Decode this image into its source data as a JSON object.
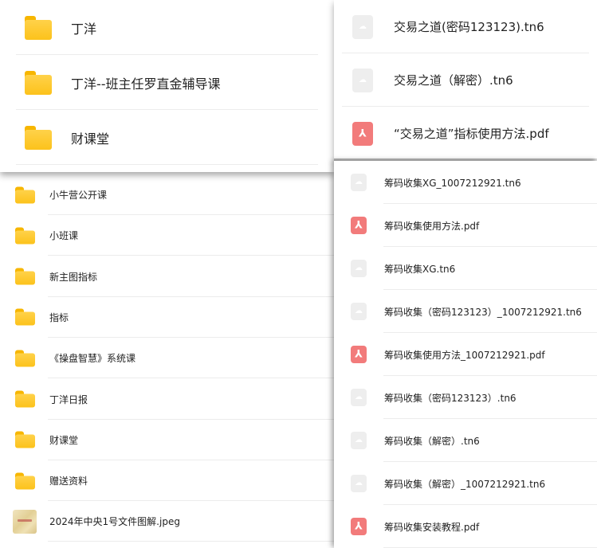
{
  "top_left_folders": [
    "丁洋",
    "丁洋--班主任罗直金辅导课",
    "财课堂"
  ],
  "top_right_files": [
    {
      "name": "交易之道(密码123123).tn6",
      "type": "tn6"
    },
    {
      "name": "交易之道（解密）.tn6",
      "type": "tn6"
    },
    {
      "name": "“交易之道”指标使用方法.pdf",
      "type": "pdf"
    }
  ],
  "bottom_left_items": [
    {
      "name": "小牛营公开课",
      "type": "folder"
    },
    {
      "name": "小班课",
      "type": "folder"
    },
    {
      "name": "新主图指标",
      "type": "folder"
    },
    {
      "name": "指标",
      "type": "folder"
    },
    {
      "name": "《操盘智慧》系统课",
      "type": "folder"
    },
    {
      "name": "丁洋日报",
      "type": "folder"
    },
    {
      "name": "财课堂",
      "type": "folder"
    },
    {
      "name": "赠送资料",
      "type": "folder"
    },
    {
      "name": "2024年中央1号文件图解.jpeg",
      "type": "image"
    }
  ],
  "bottom_right_files": [
    {
      "name": "筹码收集XG_1007212921.tn6",
      "type": "tn6"
    },
    {
      "name": "筹码收集使用方法.pdf",
      "type": "pdf"
    },
    {
      "name": "筹码收集XG.tn6",
      "type": "tn6"
    },
    {
      "name": "筹码收集（密码123123）_1007212921.tn6",
      "type": "tn6"
    },
    {
      "name": "筹码收集使用方法_1007212921.pdf",
      "type": "pdf"
    },
    {
      "name": "筹码收集（密码123123）.tn6",
      "type": "tn6"
    },
    {
      "name": "筹码收集（解密）.tn6",
      "type": "tn6"
    },
    {
      "name": "筹码收集（解密）_1007212921.tn6",
      "type": "tn6"
    },
    {
      "name": "筹码收集安装教程.pdf",
      "type": "pdf"
    }
  ],
  "colors": {
    "folder": "#fcc21b",
    "pdf_icon": "#f27b7b",
    "file_icon": "#eeeeee"
  }
}
